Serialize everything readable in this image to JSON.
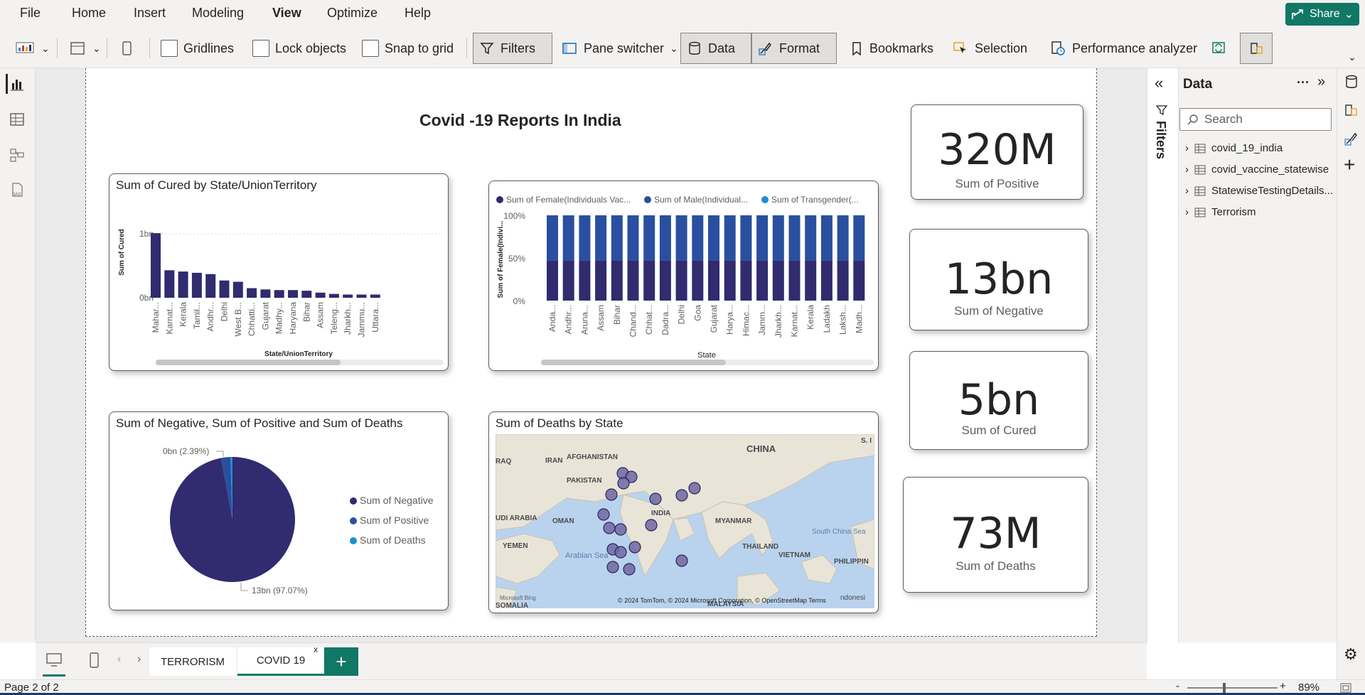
{
  "menu": {
    "items": [
      "File",
      "Home",
      "Insert",
      "Modeling",
      "View",
      "Optimize",
      "Help"
    ],
    "active": "View",
    "share_label": "Share"
  },
  "ribbon": {
    "gridlines": "Gridlines",
    "lock_objects": "Lock objects",
    "snap_to_grid": "Snap to grid",
    "filters": "Filters",
    "pane_switcher": "Pane switcher",
    "data": "Data",
    "format": "Format",
    "bookmarks": "Bookmarks",
    "selection": "Selection",
    "performance_analyzer": "Performance analyzer"
  },
  "report": {
    "title": "Covid -19 Reports In India",
    "cured_chart": {
      "title": "Sum of Cured by State/UnionTerritory",
      "ylabel": "Sum of Cured",
      "xlabel": "State/UnionTerritory",
      "y_ticks": [
        "1bn",
        "0bn"
      ]
    },
    "vaccine_chart": {
      "legend": [
        "Sum of Female(Individuals Vac...",
        "Sum of Male(Individual...",
        "Sum of Transgender(..."
      ],
      "ylabel": "Sum of Female(Indivi...",
      "xlabel": "State",
      "y_ticks": [
        "100%",
        "50%",
        "0%"
      ]
    },
    "pie_chart": {
      "title": "Sum of Negative, Sum of Positive and Sum of Deaths",
      "label_small": "0bn (2.39%)",
      "label_large": "13bn (97.07%)",
      "legend": [
        "Sum of Negative",
        "Sum of Positive",
        "Sum of Deaths"
      ]
    },
    "map": {
      "title": "Sum of Deaths by State",
      "labels": {
        "china": "CHINA",
        "iran": "IRAN",
        "afghanistan": "AFGHANISTAN",
        "pakistan": "PAKISTAN",
        "india": "INDIA",
        "myanmar": "MYANMAR",
        "thailand": "THAILAND",
        "vietnam": "VIETNAM",
        "oman": "OMAN",
        "yemen": "YEMEN",
        "somalia": "SOMALIA",
        "arabia": "UDI ARABIA",
        "iraq": "RAQ",
        "arabian_sea": "Arabian Sea",
        "scs": "South China Sea",
        "philippines": "PHILIPPIN",
        "skorea": "S. I",
        "malaysia": "MALAYSIA",
        "indonesia": "ndonesi"
      },
      "attribution": "© 2024 TomTom, © 2024 Microsoft Corporation, © OpenStreetMap  Terms",
      "bing": "Microsoft Bing"
    },
    "kpis": [
      {
        "value": "320M",
        "label": "Sum of Positive"
      },
      {
        "value": "13bn",
        "label": "Sum of Negative"
      },
      {
        "value": "5bn",
        "label": "Sum of Cured"
      },
      {
        "value": "73M",
        "label": "Sum of Deaths"
      }
    ]
  },
  "chart_data": [
    {
      "type": "bar",
      "title": "Sum of Cured by State/UnionTerritory",
      "xlabel": "State/UnionTerritory",
      "ylabel": "Sum of Cured",
      "categories": [
        "Mahar...",
        "Karnat...",
        "Kerala",
        "Tamil...",
        "Andhr...",
        "Delhi",
        "West B...",
        "Chhatti...",
        "Gujarat",
        "Madhy...",
        "Haryana",
        "Bihar",
        "Assam",
        "Teleng...",
        "Jharkh...",
        "Jammu...",
        "Uttara..."
      ],
      "values": [
        1.01,
        0.43,
        0.41,
        0.39,
        0.37,
        0.27,
        0.25,
        0.15,
        0.13,
        0.12,
        0.12,
        0.11,
        0.08,
        0.06,
        0.05,
        0.05,
        0.05
      ],
      "unit": "bn",
      "ylim": [
        0,
        1.2
      ],
      "color": "#312b6f"
    },
    {
      "type": "bar",
      "stacked": "100%",
      "xlabel": "State",
      "ylabel": "Sum of Female(Indivi...",
      "categories": [
        "Anda...",
        "Andhr...",
        "Aruna...",
        "Assam",
        "Bihar",
        "Chand...",
        "Chhat...",
        "Dadra...",
        "Delhi",
        "Goa",
        "Gujarat",
        "Harya...",
        "Himac...",
        "Jamm...",
        "Jharkh...",
        "Karnat...",
        "Kerala",
        "Ladakh",
        "Laksh...",
        "Madh..."
      ],
      "series": [
        {
          "name": "Sum of Female(Individuals Vac...",
          "values": [
            47,
            47,
            47,
            47,
            47,
            47,
            47,
            47,
            47,
            47,
            47,
            47,
            47,
            47,
            47,
            47,
            47,
            47,
            47,
            47
          ],
          "color": "#312b6f"
        },
        {
          "name": "Sum of Male(Individual...",
          "values": [
            53,
            53,
            53,
            53,
            53,
            53,
            53,
            53,
            53,
            53,
            53,
            53,
            53,
            53,
            53,
            53,
            53,
            53,
            53,
            53
          ],
          "color": "#2a4fa0"
        },
        {
          "name": "Sum of Transgender(...",
          "values": [
            0,
            0,
            0,
            0,
            0,
            0,
            0,
            0,
            0,
            0,
            0,
            0,
            0,
            0,
            0,
            0,
            0,
            0,
            0,
            0
          ],
          "color": "#1a8fd0"
        }
      ],
      "ylim": [
        0,
        100
      ]
    },
    {
      "type": "pie",
      "title": "Sum of Negative, Sum of Positive and Sum of Deaths",
      "slices": [
        {
          "name": "Sum of Negative",
          "value": 97.07,
          "color": "#312b6f"
        },
        {
          "name": "Sum of Positive",
          "value": 2.39,
          "color": "#2a4fa0"
        },
        {
          "name": "Sum of Deaths",
          "value": 0.54,
          "color": "#1a8fd0"
        }
      ]
    }
  ],
  "pages": {
    "tabs": [
      "TERRORISM",
      "COVID 19"
    ],
    "active": "COVID 19",
    "close": "x"
  },
  "data_pane": {
    "title": "Data",
    "search_placeholder": "Search",
    "tables": [
      "covid_19_india",
      "covid_vaccine_statewise",
      "StatewiseTestingDetails...",
      "Terrorism"
    ]
  },
  "filters_label": "Filters",
  "status": {
    "page": "Page 2 of 2",
    "zoom": "89%"
  },
  "colors": {
    "accent": "#117865",
    "dark_series": "#312b6f",
    "mid_series": "#2a4fa0",
    "light_series": "#1a8fd0"
  }
}
